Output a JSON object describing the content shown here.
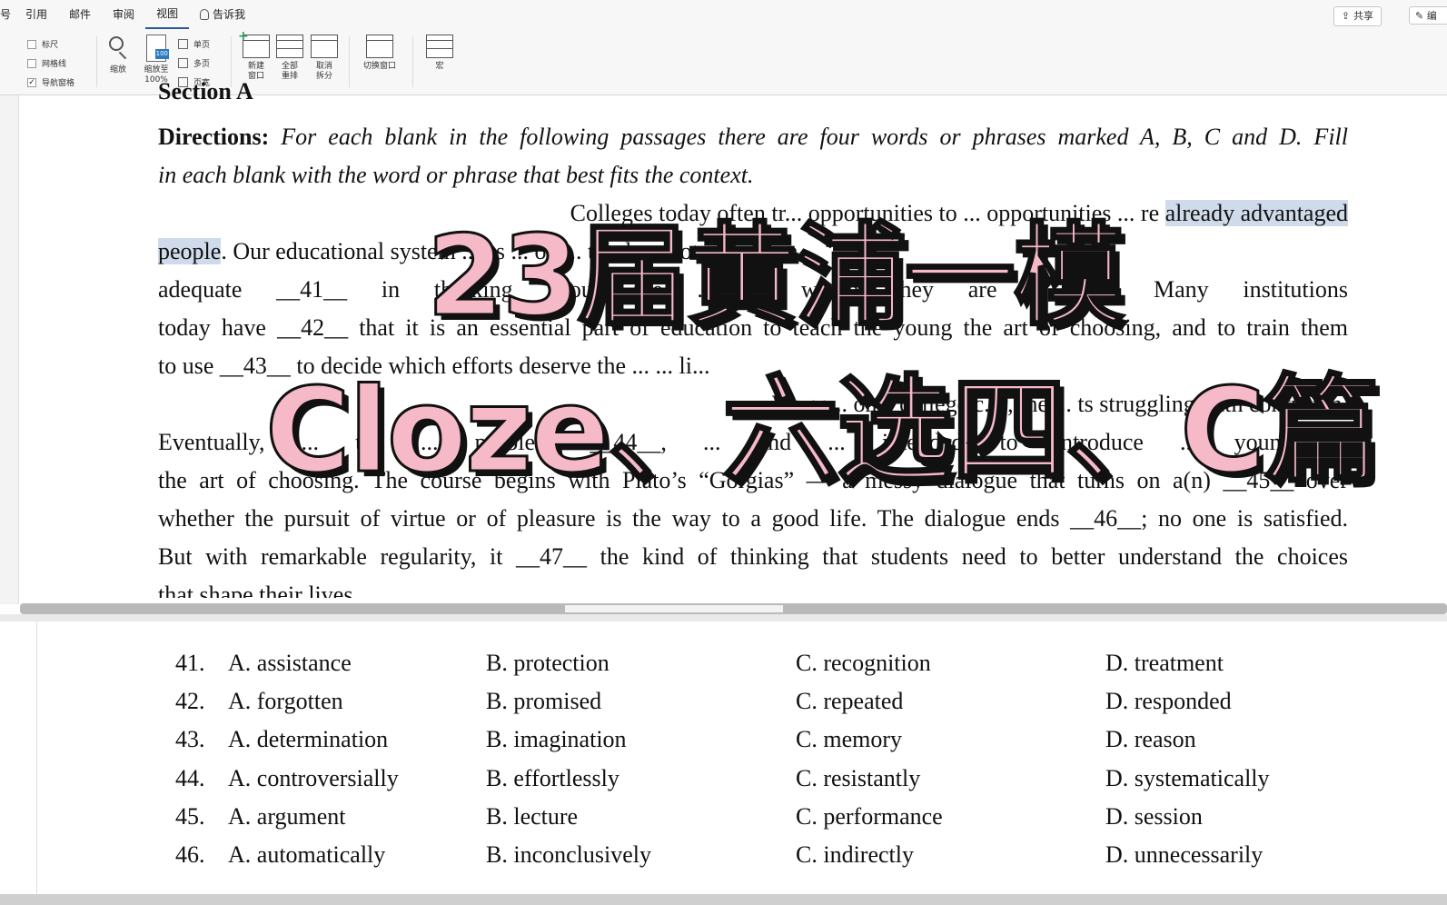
{
  "ribbon": {
    "tabs": [
      "引用",
      "邮件",
      "审阅",
      "视图"
    ],
    "edge_tab": "号",
    "active_tab": "视图",
    "tell_me": "告诉我",
    "share": "共享",
    "edit": "编",
    "show_group": [
      {
        "label": "标尺",
        "checked": false
      },
      {
        "label": "网格线",
        "checked": false
      },
      {
        "label": "导航窗格",
        "checked": true
      }
    ],
    "zoom": "缩放",
    "zoom100": "缩放至\n100%",
    "zoom_badge": "100",
    "page_views": [
      "单页",
      "多页",
      "页宽"
    ],
    "new_window": "新建\n窗口",
    "arrange_all": "全部\n重排",
    "unsplit": "取消\n拆分",
    "switch_window": "切换窗口",
    "macros": "宏"
  },
  "document": {
    "section_heading": "Section A",
    "directions_label": "Directions:",
    "directions_text_1": " For each blank in the following passages there are four words or phrases marked A, B, C and D. Fill",
    "directions_text_2": "in each blank with the word or phrase that best fits the context.",
    "p1_line1_pre": "Colleges today often tr... opportunities to ... opportunities ... re ",
    "p1_line1_hl": "already advantaged",
    "p1_line2_hl": "people",
    "p1_line2_rest": ". Our educational system ... es ... on ... t it does not give them",
    "p1_line3": "adequate __41__ in thinking about the ... ... which they are ... ing. Many institutions",
    "p1_line4": "today have __42__ that it is an essential part of education to teach the young the art of choosing, and to train them",
    "p1_line5": "to use __43__ to decide which efforts deserve the ... ... li...",
    "p2_line1": "We sp... on a college c... , the ... ts struggling with confusion.",
    "p2_line2": "Eventually, ... the ... problem __44__, ... and ... intended to introduce ... young to",
    "p2_line3": "the art of choosing. The course begins with Plato’s “Gorgias” — a messy dialogue that turns on a(n) __45__ over",
    "p2_line4": "whether the pursuit of virtue or of pleasure is the way to a good life. The dialogue ends __46__; no one is satisfied.",
    "p2_line5": "But with remarkable regularity, it __47__ the kind of thinking that students need to better understand the choices",
    "p2_line6": "that shape their lives."
  },
  "questions": [
    {
      "num": "41.",
      "a": "A. assistance",
      "b": "B. protection",
      "c": "C. recognition",
      "d": "D. treatment"
    },
    {
      "num": "42.",
      "a": "A. forgotten",
      "b": "B. promised",
      "c": "C. repeated",
      "d": "D. responded"
    },
    {
      "num": "43.",
      "a": "A. determination",
      "b": "B. imagination",
      "c": "C. memory",
      "d": "D. reason"
    },
    {
      "num": "44.",
      "a": "A. controversially",
      "b": "B. effortlessly",
      "c": "C. resistantly",
      "d": "D. systematically"
    },
    {
      "num": "45.",
      "a": "A. argument",
      "b": "B. lecture",
      "c": "C. performance",
      "d": "D. session"
    },
    {
      "num": "46.",
      "a": "A. automatically",
      "b": "B. inconclusively",
      "c": "C. indirectly",
      "d": "D. unnecessarily"
    }
  ],
  "overlay": {
    "line1": "23届黄浦一模",
    "line2": "Cloze、六选四、C篇",
    "fill_color": "#f6b9c8",
    "stroke_color": "#111111"
  },
  "colors": {
    "accent": "#2b579a",
    "highlight": "#cfdaea"
  }
}
